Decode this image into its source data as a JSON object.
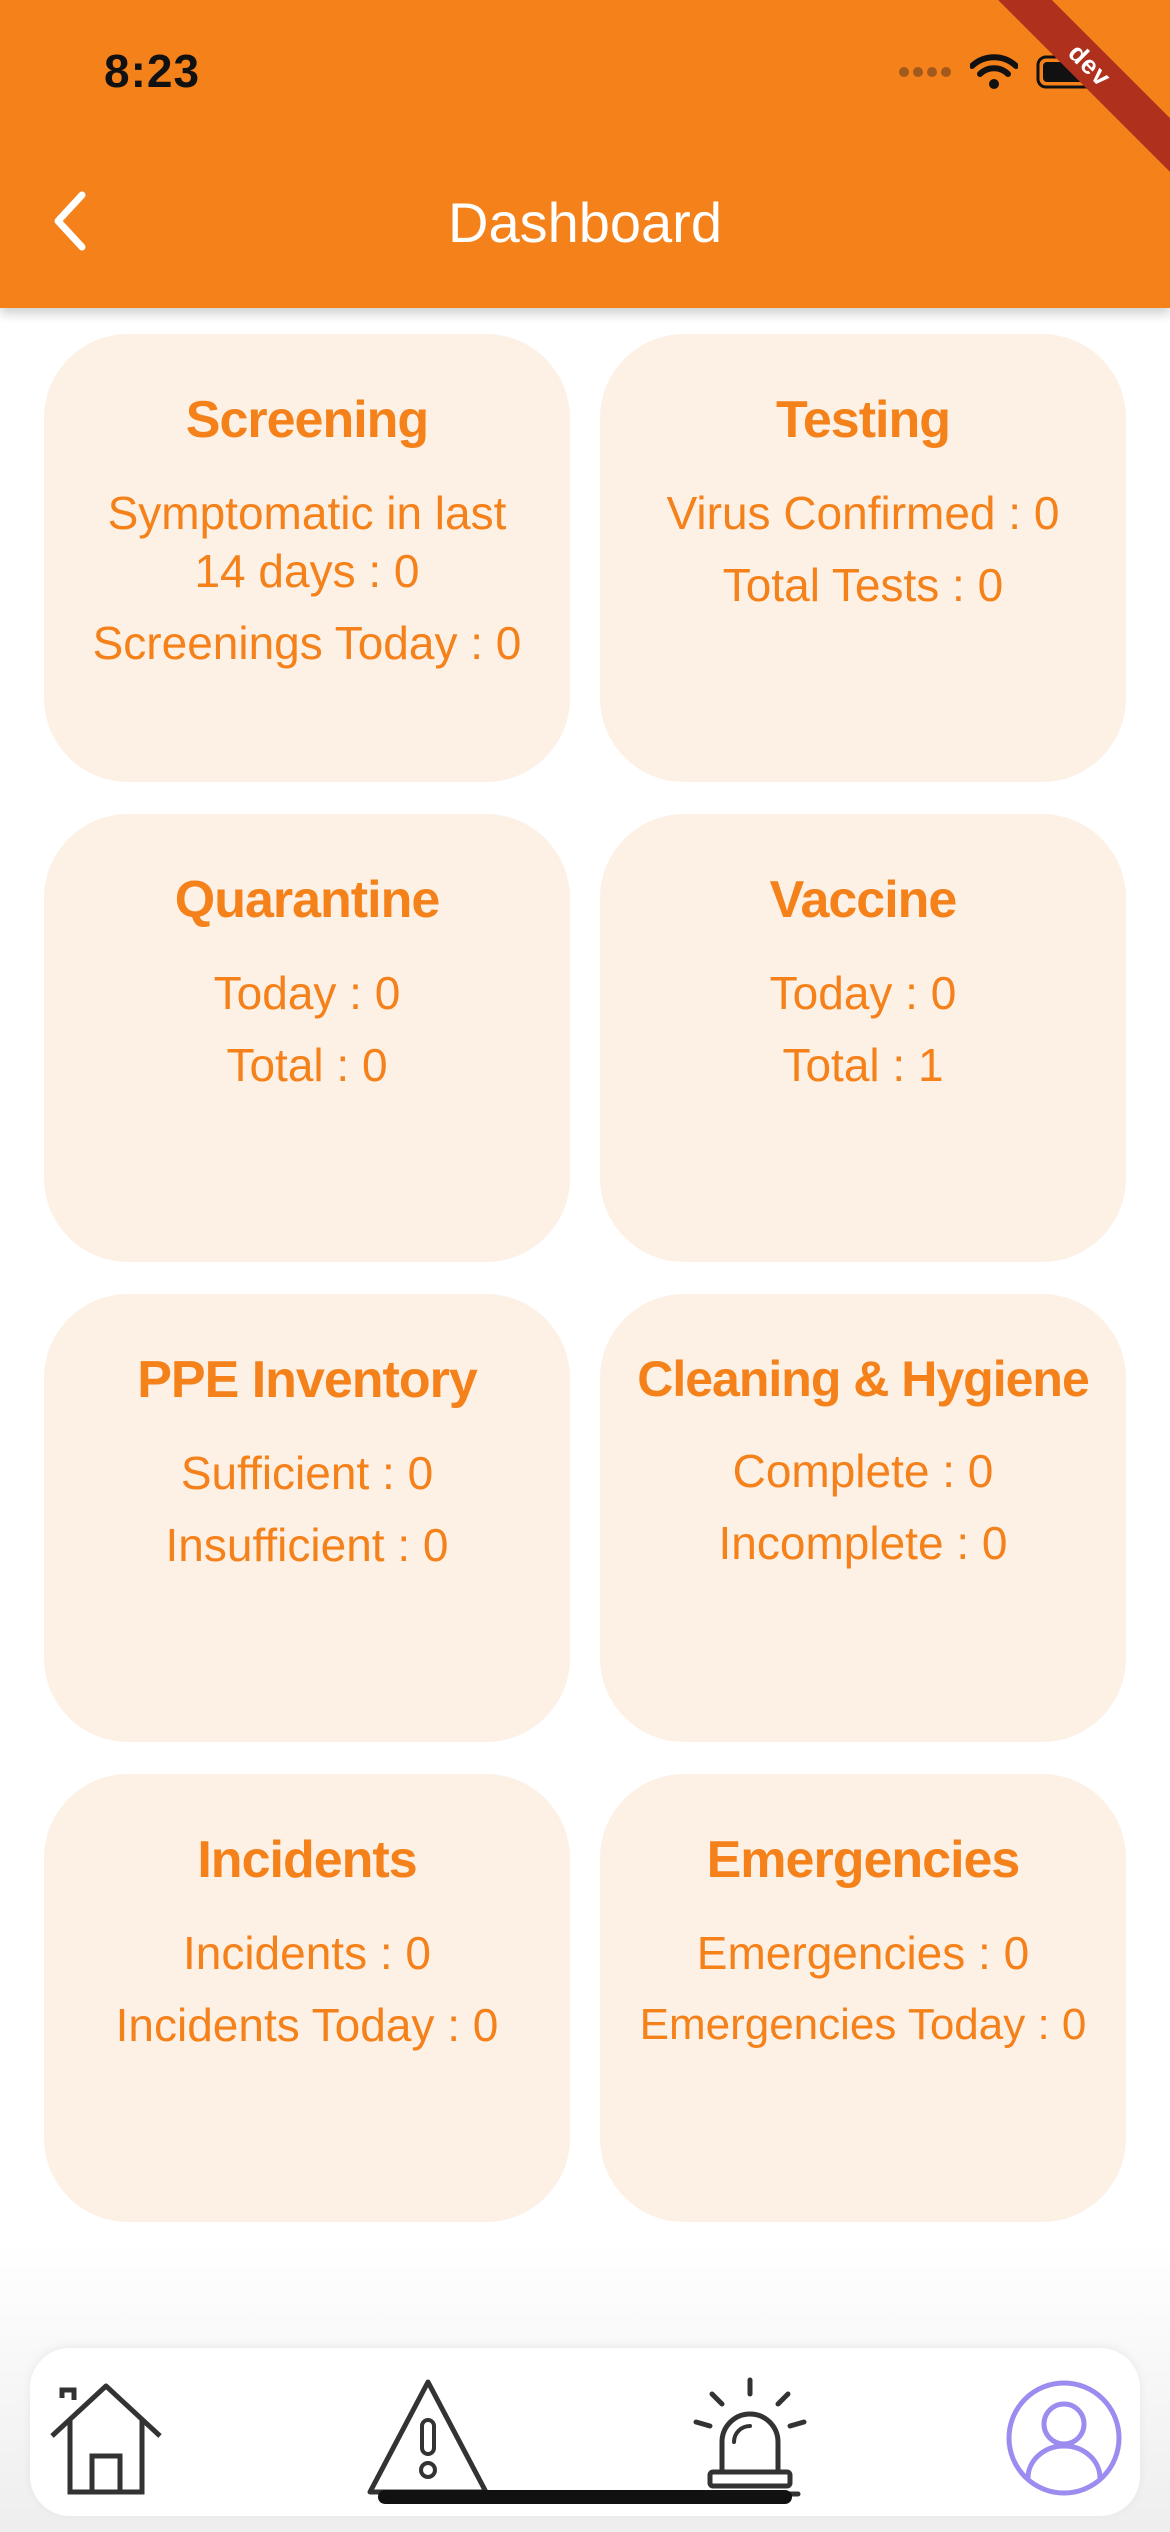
{
  "status_bar": {
    "time": "8:23",
    "ribbon": "dev"
  },
  "header": {
    "title": "Dashboard"
  },
  "cards": [
    {
      "title": "Screening",
      "lines": [
        "Symptomatic in last\n14 days : 0",
        "Screenings Today : 0"
      ]
    },
    {
      "title": "Testing",
      "lines": [
        "Virus Confirmed : 0",
        "Total Tests : 0"
      ]
    },
    {
      "title": "Quarantine",
      "lines": [
        "Today : 0",
        "Total : 0"
      ]
    },
    {
      "title": "Vaccine",
      "lines": [
        "Today : 0",
        "Total : 1"
      ]
    },
    {
      "title": "PPE Inventory",
      "lines": [
        "Sufficient : 0",
        "Insufficient : 0"
      ]
    },
    {
      "title": "Cleaning & Hygiene",
      "lines": [
        "Complete : 0",
        "Incomplete : 0"
      ]
    },
    {
      "title": "Incidents",
      "lines": [
        "Incidents : 0",
        "Incidents Today : 0"
      ]
    },
    {
      "title": "Emergencies",
      "lines": [
        "Emergencies : 0",
        "Emergencies Today : 0"
      ]
    }
  ],
  "bottom_nav": {
    "items": [
      {
        "icon": "home-icon"
      },
      {
        "icon": "warning-icon"
      },
      {
        "icon": "alarm-siren-icon"
      },
      {
        "icon": "profile-icon"
      }
    ]
  },
  "colors": {
    "brand": "#F5811B",
    "card_bg": "#FDF0E4",
    "ribbon": "#B0301E",
    "profile_icon": "#9C8CF0"
  }
}
